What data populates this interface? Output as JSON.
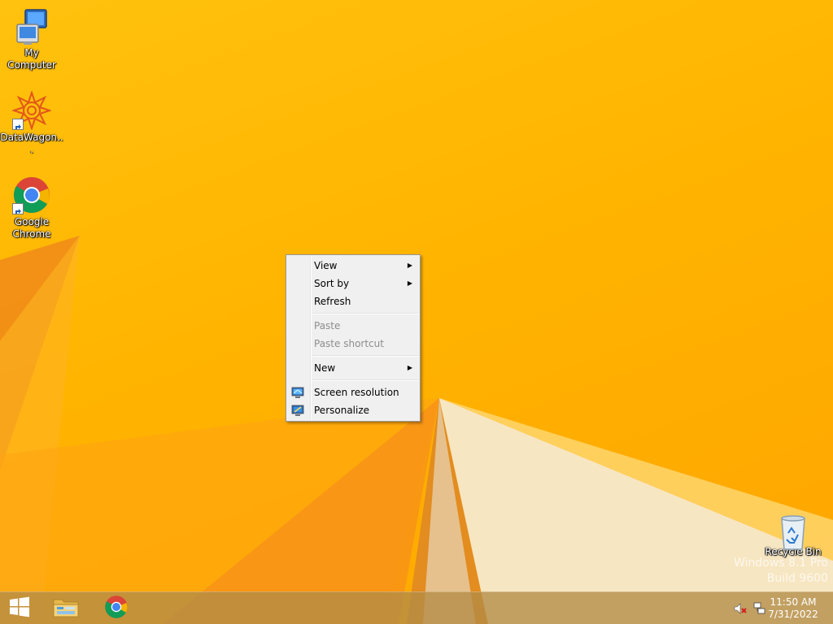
{
  "desktop": {
    "icons": [
      {
        "label": "My Computer",
        "icon": "computer-icon"
      },
      {
        "label": "DataWagon...",
        "icon": "datawagon-icon"
      },
      {
        "label": "Google Chrome",
        "icon": "chrome-icon"
      },
      {
        "label": "Recycle Bin",
        "icon": "recycle-bin-icon"
      }
    ],
    "watermark": {
      "line1": "Windows 8.1 Pro",
      "line2": "Build 9600"
    }
  },
  "context_menu": {
    "items": [
      {
        "label": "View",
        "submenu": true,
        "disabled": false
      },
      {
        "label": "Sort by",
        "submenu": true,
        "disabled": false
      },
      {
        "label": "Refresh",
        "submenu": false,
        "disabled": false
      },
      {
        "label": "Paste",
        "submenu": false,
        "disabled": true
      },
      {
        "label": "Paste shortcut",
        "submenu": false,
        "disabled": true
      },
      {
        "label": "New",
        "submenu": true,
        "disabled": false
      },
      {
        "label": "Screen resolution",
        "submenu": false,
        "disabled": false,
        "icon": "screen-resolution-icon"
      },
      {
        "label": "Personalize",
        "submenu": false,
        "disabled": false,
        "icon": "personalize-icon"
      }
    ],
    "submenu_glyph": "▶"
  },
  "taskbar": {
    "start_icon": "windows-logo-icon",
    "pinned": [
      {
        "name": "file-explorer",
        "icon": "folder-icon"
      },
      {
        "name": "chrome",
        "icon": "chrome-icon"
      }
    ],
    "tray": {
      "icons": [
        "speaker-muted-icon",
        "network-icon"
      ],
      "time": "11:50 AM",
      "date": "7/31/2022"
    }
  },
  "colors": {
    "wallpaper": "#ffb400",
    "taskbar": "#b48c46",
    "menu_bg": "#f0f0f0"
  }
}
